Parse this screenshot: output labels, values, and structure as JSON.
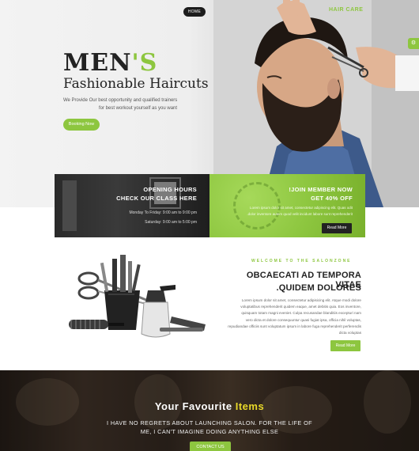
{
  "nav": {
    "home_label": "HOME",
    "brand": "HAIR CARE"
  },
  "hero": {
    "title_main": "MEN",
    "title_accent": "'S",
    "subtitle": "Fashionable Haircuts",
    "desc_line1": "We Provide Our best opportunity and qualified trainers",
    "desc_line2": "for best workout yourself as you want",
    "button_label": "Booking Now"
  },
  "opening": {
    "heading1": "OPENING HOURS",
    "heading2": "CHECK OUR CLASS HERE",
    "line1": "Monday To Friday: 9:00 am to 9:00 pm",
    "line2": "Saturday: 9:00 am to 5:00 pm"
  },
  "member": {
    "heading1": "!JOIN MEMBER NOW",
    "heading2": "GET 40% OFF",
    "line1": "Lorem ipsum dolor sit amet, consectetur adipiscing elit. Quas odit",
    "line2": ".dolor inventore autem quod velit incidunt labore sunt reprehenderit",
    "button_label": "Read More"
  },
  "welcome": {
    "tag": "WELCOME TO THE SALONZONE",
    "heading1": "OBCAECATI AD TEMPORA VITAE",
    "heading2": ".QUIDEM DOLORES",
    "body": [
      "Lorem ipsum dolor sit amet, consectetur adipisicing elit. Atque modi dolore",
      "voluptatibus reprehenderit quidem eaque, amet debitis quia. Eos inventore,",
      "quisquam totam magni eveniet. Culpa recusandae blanditiis excepturi nam",
      "vero dicta et dolore consequuntur quasi fugiat ipsa, officia nihil voluptas,",
      "repudiandae officiis sunt voluptatum ipsum in labore fuga reprehenderit perferendis",
      "dicta voluptas"
    ],
    "button_label": "Read More"
  },
  "favourites": {
    "title_main": "Your Favourite",
    "title_accent": "Items",
    "line1": "I HAVE NO REGRETS ABOUT LAUNCHING SALON. FOR THE LIFE OF",
    "line2": "ME, I CAN'T IMAGINE DOING ANYTHING ELSE",
    "button_label": "CONTACT US"
  },
  "colors": {
    "accent": "#8dc63f",
    "dark": "#222222",
    "yellow": "#e8d829"
  }
}
